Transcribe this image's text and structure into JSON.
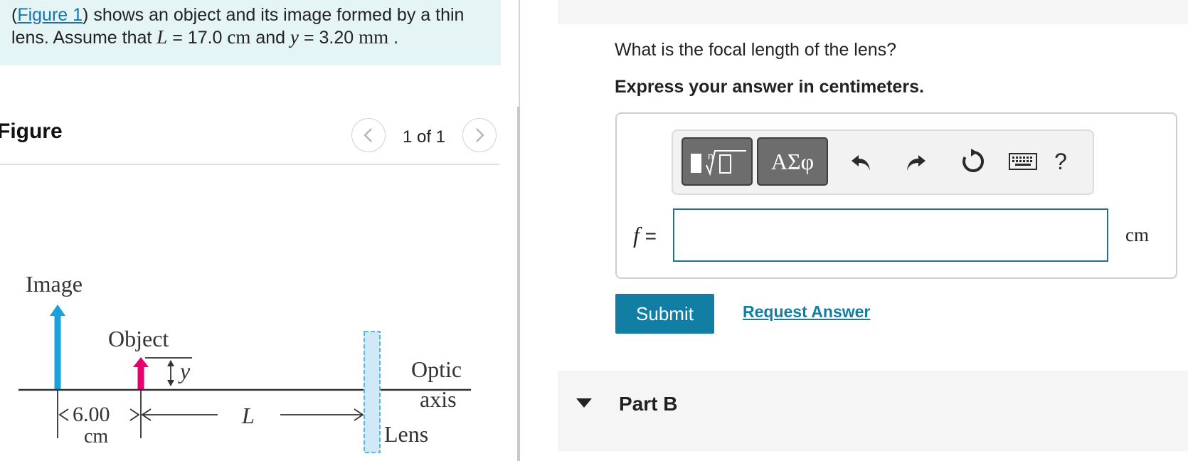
{
  "problem": {
    "open_paren": "(",
    "figure_link": "Figure 1",
    "text_1": ") shows an object and its image formed by a thin lens. Assume that ",
    "var_L": "L",
    "eq_1": " = 17.0 ",
    "unit_1": "cm",
    "text_2": " and ",
    "var_y": "y",
    "eq_2": " = 3.20 ",
    "unit_2": "mm",
    "text_3": " ."
  },
  "figure": {
    "heading": "Figure",
    "pager": {
      "count": "1 of 1",
      "prev_icon": "chevron-left-icon",
      "next_icon": "chevron-right-icon"
    },
    "diagram": {
      "image_label": "Image",
      "object_label": "Object",
      "y_label": "y",
      "distance_value": "6.00",
      "distance_unit": "cm",
      "L_label": "L",
      "optic_label": "Optic",
      "axis_label": "axis",
      "lens_label": "Lens",
      "image_color": "#1ba0dc",
      "object_color": "#e5006e",
      "lens_color": "#5bb5e6"
    }
  },
  "part_a": {
    "question": "What is the focal length of the lens?",
    "instruction": "Express your answer in centimeters.",
    "toolbar": {
      "templates_icon": "templates-icon",
      "greek_label": "ΑΣφ",
      "undo_icon": "undo-icon",
      "redo_icon": "redo-icon",
      "reset_icon": "reset-icon",
      "keyboard_icon": "keyboard-icon",
      "help_label": "?"
    },
    "var_f": "f",
    "equals": " =",
    "input_value": "",
    "unit": "cm",
    "submit_label": "Submit",
    "request_label": "Request Answer"
  },
  "part_b": {
    "title": "Part B"
  },
  "colors": {
    "accent": "#127ea3",
    "problem_bg": "#e5f4f4",
    "input_border": "#1a7591"
  }
}
